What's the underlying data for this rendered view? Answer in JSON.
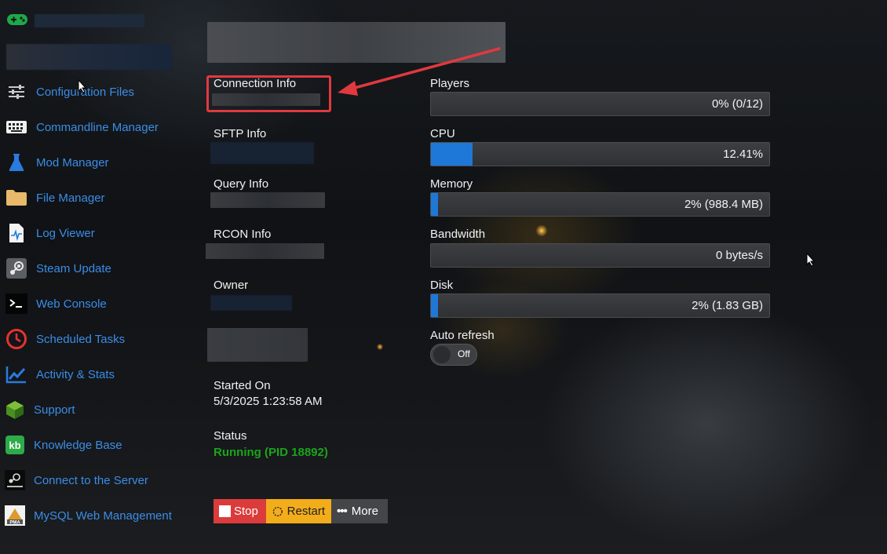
{
  "sidebar": {
    "brand_icon": "gamepad-icon",
    "items": [
      {
        "label": "Configuration Files",
        "icon": "sliders-icon"
      },
      {
        "label": "Commandline Manager",
        "icon": "keyboard-icon"
      },
      {
        "label": "Mod Manager",
        "icon": "flask-icon"
      },
      {
        "label": "File Manager",
        "icon": "folder-icon"
      },
      {
        "label": "Log Viewer",
        "icon": "log-file-icon"
      },
      {
        "label": "Steam Update",
        "icon": "steam-icon"
      },
      {
        "label": "Web Console",
        "icon": "terminal-icon"
      },
      {
        "label": "Scheduled Tasks",
        "icon": "clock-icon"
      },
      {
        "label": "Activity & Stats",
        "icon": "chart-line-icon"
      },
      {
        "label": "Support",
        "icon": "support-cube-icon"
      },
      {
        "label": "Knowledge Base",
        "icon": "kb-icon"
      },
      {
        "label": "Connect to the Server",
        "icon": "steam-logo-icon"
      },
      {
        "label": "MySQL Web Management",
        "icon": "phpmyadmin-icon"
      }
    ]
  },
  "info": {
    "connection_label": "Connection Info",
    "sftp_label": "SFTP Info",
    "query_label": "Query Info",
    "rcon_label": "RCON Info",
    "owner_label": "Owner",
    "started_label": "Started On",
    "started_value": "5/3/2025 1:23:58 AM",
    "status_label": "Status",
    "status_value": "Running (PID 18892)"
  },
  "actions": {
    "stop": "Stop",
    "restart": "Restart",
    "more": "More"
  },
  "stats": {
    "players": {
      "label": "Players",
      "text": "0% (0/12)",
      "percent": 0
    },
    "cpu": {
      "label": "CPU",
      "text": "12.41%",
      "percent": 12.41
    },
    "memory": {
      "label": "Memory",
      "text": "2% (988.4 MB)",
      "percent": 2
    },
    "bandwidth": {
      "label": "Bandwidth",
      "text": "0 bytes/s",
      "percent": 0
    },
    "disk": {
      "label": "Disk",
      "text": "2% (1.83 GB)",
      "percent": 2
    },
    "auto_refresh_label": "Auto refresh",
    "auto_refresh_state": "Off"
  },
  "colors": {
    "link": "#3b8de6",
    "bar_fill": "#1e78d8",
    "status_running": "#1aa51a",
    "stop": "#dc3b3b",
    "restart": "#f3ad1b",
    "highlight": "#e0393e"
  }
}
